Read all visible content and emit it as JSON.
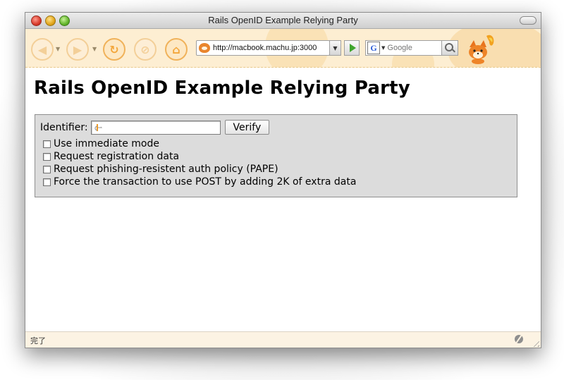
{
  "window": {
    "title": "Rails OpenID Example Relying Party"
  },
  "toolbar": {
    "back_icon": "back-arrow-icon",
    "forward_icon": "forward-arrow-icon",
    "reload_icon": "reload-icon",
    "stop_icon": "stop-icon",
    "home_icon": "home-icon",
    "url": "http://macbook.machu.jp:3000",
    "search_engine_letter": "G",
    "search_placeholder": "Google"
  },
  "page": {
    "title": "Rails OpenID Example Relying Party",
    "form": {
      "identifier_label": "Identifier:",
      "identifier_value": "",
      "verify_label": "Verify",
      "options": [
        {
          "label": "Use immediate mode",
          "checked": false
        },
        {
          "label": "Request registration data",
          "checked": false
        },
        {
          "label": "Request phishing-resistent auth policy (PAPE)",
          "checked": false
        },
        {
          "label": "Force the transaction to use POST by adding 2K of extra data",
          "checked": false
        }
      ]
    }
  },
  "status": {
    "text": "完了"
  },
  "colors": {
    "toolbar_bg": "#fdeed2",
    "form_bg": "#dcdcdc",
    "status_bg": "#fcf3e3",
    "accent_orange": "#f3a63a"
  }
}
